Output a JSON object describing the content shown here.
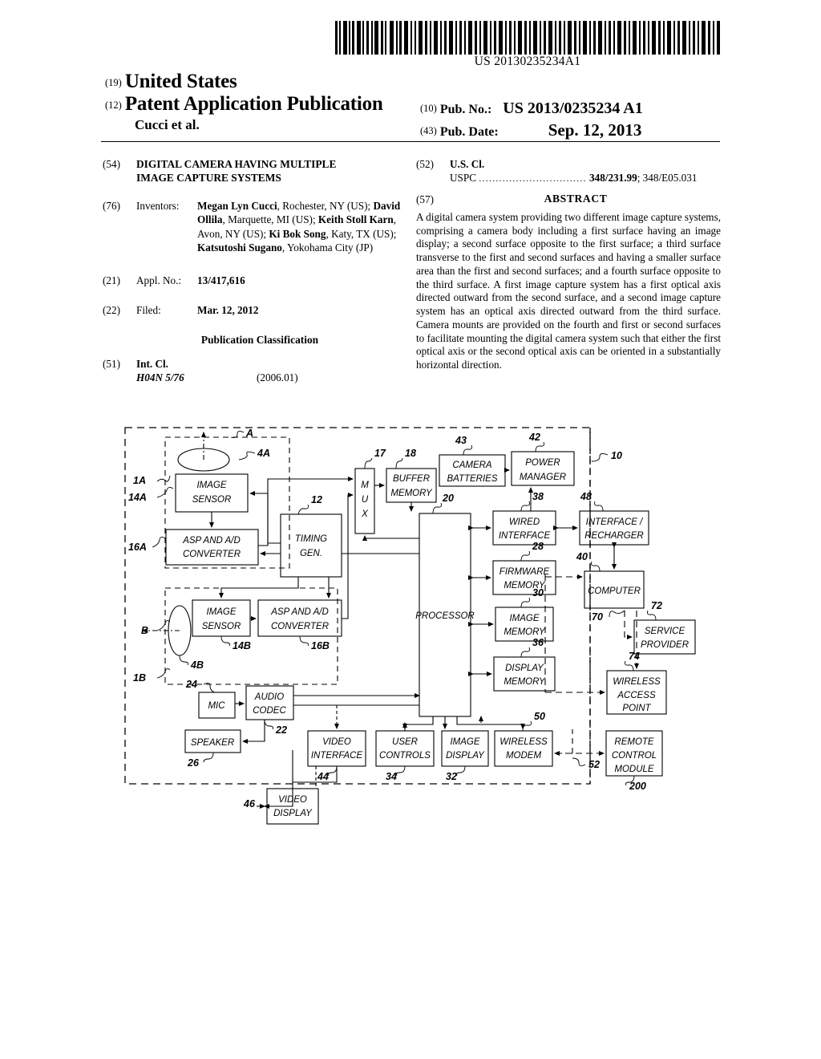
{
  "barcode": {
    "number": "US 20130235234A1",
    "icon": "barcode-icon"
  },
  "header": {
    "inid_19": "(19)",
    "country": "United States",
    "inid_12": "(12)",
    "doc_type": "Patent Application Publication",
    "applicant_line": "Cucci et al.",
    "inid_10": "(10)",
    "pub_no_label": "Pub. No.:",
    "pub_no_value": "US 2013/0235234 A1",
    "inid_43": "(43)",
    "pub_date_label": "Pub. Date:",
    "pub_date_value": "Sep. 12, 2013"
  },
  "biblio": {
    "title": {
      "inid": "(54)",
      "line1": "DIGITAL CAMERA HAVING MULTIPLE",
      "line2": "IMAGE CAPTURE SYSTEMS"
    },
    "inventors": {
      "inid": "(76)",
      "label": "Inventors:",
      "entries": [
        {
          "name": "Megan Lyn Cucci",
          "location": ", Rochester, NY (US);"
        },
        {
          "name": "David Ollila",
          "location": ", Marquette, MI (US);"
        },
        {
          "name": "Keith Stoll Karn",
          "location": ", Avon, NY (US);"
        },
        {
          "name": "Ki Bok Song",
          "location": ", Katy, TX (US);"
        },
        {
          "name": "Katsutoshi Sugano",
          "location": ", Yokohama City (JP)"
        }
      ]
    },
    "appl_no": {
      "inid": "(21)",
      "label": "Appl. No.:",
      "value": "13/417,616"
    },
    "filed": {
      "inid": "(22)",
      "label": "Filed:",
      "value": "Mar. 12, 2012"
    },
    "pub_classification_heading": "Publication Classification",
    "int_cl": {
      "inid": "(51)",
      "label": "Int. Cl.",
      "code": "H04N 5/76",
      "version": "(2006.01)"
    },
    "us_cl": {
      "inid": "(52)",
      "label": "U.S. Cl.",
      "sub_label": "USPC",
      "dots": "................................",
      "value_bold": "348/231.99",
      "value_rest": "; 348/E05.031"
    },
    "abstract": {
      "inid": "(57)",
      "heading": "ABSTRACT",
      "text": "A digital camera system providing two different image capture systems, comprising a camera body including a first surface having an image display; a second surface opposite to the first surface; a third surface transverse to the first and second surfaces and having a smaller surface area than the first and second surfaces; and a fourth surface opposite to the third surface. A first image capture system has a first optical axis directed outward from the second surface, and a second image capture system has an optical axis directed outward from the third surface. Camera mounts are provided on the fourth and first or second surfaces to facilitate mounting the digital camera system such that either the first optical axis or the second optical axis can be oriented in a substantially horizontal direction."
    }
  },
  "figure": {
    "name": "camera-system-block-diagram",
    "blocks": [
      {
        "id": "image-sensor-a",
        "lines": [
          "IMAGE",
          "SENSOR"
        ],
        "ref": "14A"
      },
      {
        "id": "asp-ad-conv-a",
        "lines": [
          "ASP AND A/D",
          "CONVERTER"
        ],
        "ref": "16A"
      },
      {
        "id": "timing-gen",
        "lines": [
          "TIMING",
          "GEN."
        ],
        "ref": "12"
      },
      {
        "id": "image-sensor-b",
        "lines": [
          "IMAGE",
          "SENSOR"
        ],
        "ref": "14B"
      },
      {
        "id": "asp-ad-conv-b",
        "lines": [
          "ASP AND A/D",
          "CONVERTER"
        ],
        "ref": "16B"
      },
      {
        "id": "mux",
        "lines": [
          "M",
          "U",
          "X"
        ],
        "ref": "17"
      },
      {
        "id": "buffer-memory",
        "lines": [
          "BUFFER",
          "MEMORY"
        ],
        "ref": "18"
      },
      {
        "id": "camera-batteries",
        "lines": [
          "CAMERA",
          "BATTERIES"
        ],
        "ref": "43"
      },
      {
        "id": "power-manager",
        "lines": [
          "POWER",
          "MANAGER"
        ],
        "ref": "42"
      },
      {
        "id": "processor",
        "lines": [
          "PROCESSOR"
        ],
        "ref": "20"
      },
      {
        "id": "wired-interface",
        "lines": [
          "WIRED",
          "INTERFACE"
        ],
        "ref": "38"
      },
      {
        "id": "firmware-memory",
        "lines": [
          "FIRMWARE",
          "MEMORY"
        ],
        "ref": "28"
      },
      {
        "id": "image-memory",
        "lines": [
          "IMAGE",
          "MEMORY"
        ],
        "ref": "30"
      },
      {
        "id": "display-memory",
        "lines": [
          "DISPLAY",
          "MEMORY"
        ],
        "ref": "36"
      },
      {
        "id": "interface-recharger",
        "lines": [
          "INTERFACE /",
          "RECHARGER"
        ],
        "ref": "48"
      },
      {
        "id": "computer",
        "lines": [
          "COMPUTER"
        ],
        "ref": "40"
      },
      {
        "id": "service-provider",
        "lines": [
          "SERVICE",
          "PROVIDER"
        ],
        "ref": "72"
      },
      {
        "id": "wireless-access-point",
        "lines": [
          "WIRELESS",
          "ACCESS",
          "POINT"
        ],
        "ref": "74"
      },
      {
        "id": "remote-control-module",
        "lines": [
          "REMOTE",
          "CONTROL",
          "MODULE"
        ],
        "ref": "200"
      },
      {
        "id": "mic",
        "lines": [
          "MIC"
        ],
        "ref": "24"
      },
      {
        "id": "audio-codec",
        "lines": [
          "AUDIO",
          "CODEC"
        ],
        "ref": "22"
      },
      {
        "id": "speaker",
        "lines": [
          "SPEAKER"
        ],
        "ref": "26"
      },
      {
        "id": "video-interface",
        "lines": [
          "VIDEO",
          "INTERFACE"
        ],
        "ref": "44"
      },
      {
        "id": "user-controls",
        "lines": [
          "USER",
          "CONTROLS"
        ],
        "ref": "34"
      },
      {
        "id": "image-display",
        "lines": [
          "IMAGE",
          "DISPLAY"
        ],
        "ref": "32"
      },
      {
        "id": "wireless-modem",
        "lines": [
          "WIRELESS",
          "MODEM"
        ],
        "ref": "50"
      },
      {
        "id": "video-display",
        "lines": [
          "VIDEO",
          "DISPLAY"
        ],
        "ref": "46"
      }
    ],
    "ref_labels": [
      "A",
      "4A",
      "1A",
      "14A",
      "16A",
      "12",
      "17",
      "18",
      "43",
      "42",
      "10",
      "20",
      "38",
      "48",
      "28",
      "40",
      "30",
      "72",
      "36",
      "70",
      "74",
      "50",
      "B",
      "1B",
      "4B",
      "14B",
      "16B",
      "24",
      "22",
      "26",
      "44",
      "34",
      "32",
      "52",
      "200"
    ]
  }
}
